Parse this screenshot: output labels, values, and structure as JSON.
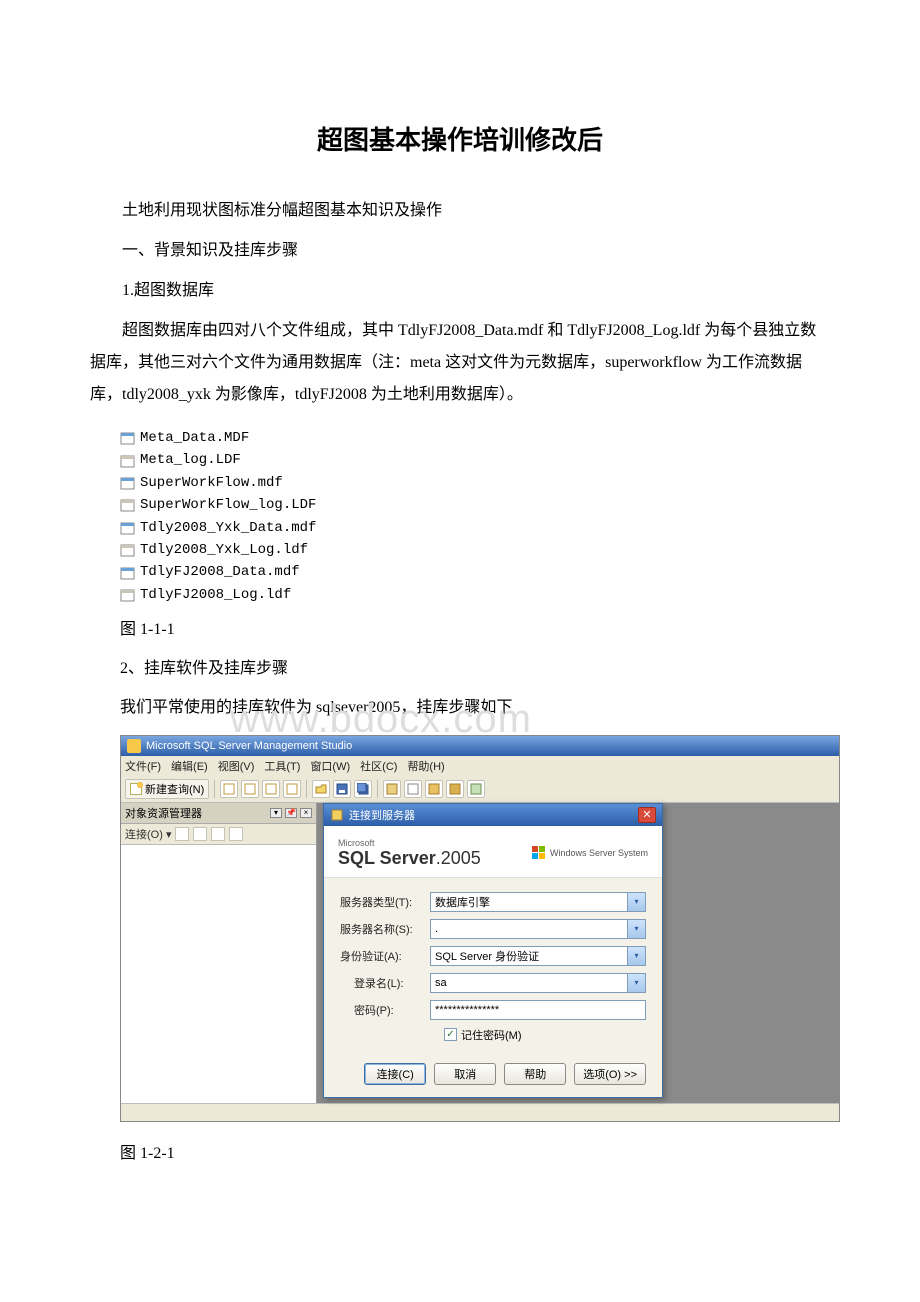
{
  "title": "超图基本操作培训修改后",
  "intro": "土地利用现状图标准分幅超图基本知识及操作",
  "section1_heading": "一、背景知识及挂库步骤",
  "s1_1_heading": "1.超图数据库",
  "s1_1_body": "超图数据库由四对八个文件组成，其中 TdlyFJ2008_Data.mdf 和 TdlyFJ2008_Log.ldf 为每个县独立数据库，其他三对六个文件为通用数据库（注：meta 这对文件为元数据库，superworkflow 为工作流数据库，tdly2008_yxk 为影像库，tdlyFJ2008 为土地利用数据库）。",
  "files": [
    "Meta_Data.MDF",
    "Meta_log.LDF",
    "SuperWorkFlow.mdf",
    "SuperWorkFlow_log.LDF",
    "Tdly2008_Yxk_Data.mdf",
    "Tdly2008_Yxk_Log.ldf",
    "TdlyFJ2008_Data.mdf",
    "TdlyFJ2008_Log.ldf"
  ],
  "fig111": "图 1-1-1",
  "s1_2_heading": "2、挂库软件及挂库步骤",
  "s1_2_body": "我们平常使用的挂库软件为 sqlsever2005，挂库步骤如下",
  "fig121": "图 1-2-1",
  "watermark": "www.bdocx.com",
  "ssms": {
    "title": "Microsoft SQL Server Management Studio",
    "menus": {
      "file": "文件(F)",
      "edit": "编辑(E)",
      "view": "视图(V)",
      "tools": "工具(T)",
      "window": "窗口(W)",
      "community": "社区(C)",
      "help": "帮助(H)"
    },
    "toolbar": {
      "newquery": "新建查询(N)"
    },
    "object_explorer": {
      "title": "对象资源管理器",
      "connect": "连接(O)"
    },
    "dialog": {
      "title": "连接到服务器",
      "logo_ms": "Microsoft",
      "logo_sql_bold": "SQL Server",
      "logo_year": ".2005",
      "wss": "Windows Server System",
      "labels": {
        "server_type": "服务器类型(T):",
        "server_name": "服务器名称(S):",
        "auth": "身份验证(A):",
        "login": "登录名(L):",
        "password": "密码(P):"
      },
      "values": {
        "server_type": "数据库引擎",
        "server_name": ".",
        "auth": "SQL Server 身份验证",
        "login": "sa",
        "password": "***************"
      },
      "remember": "记住密码(M)",
      "buttons": {
        "connect": "连接(C)",
        "cancel": "取消",
        "help": "帮助",
        "options": "选项(O) >>"
      }
    }
  }
}
